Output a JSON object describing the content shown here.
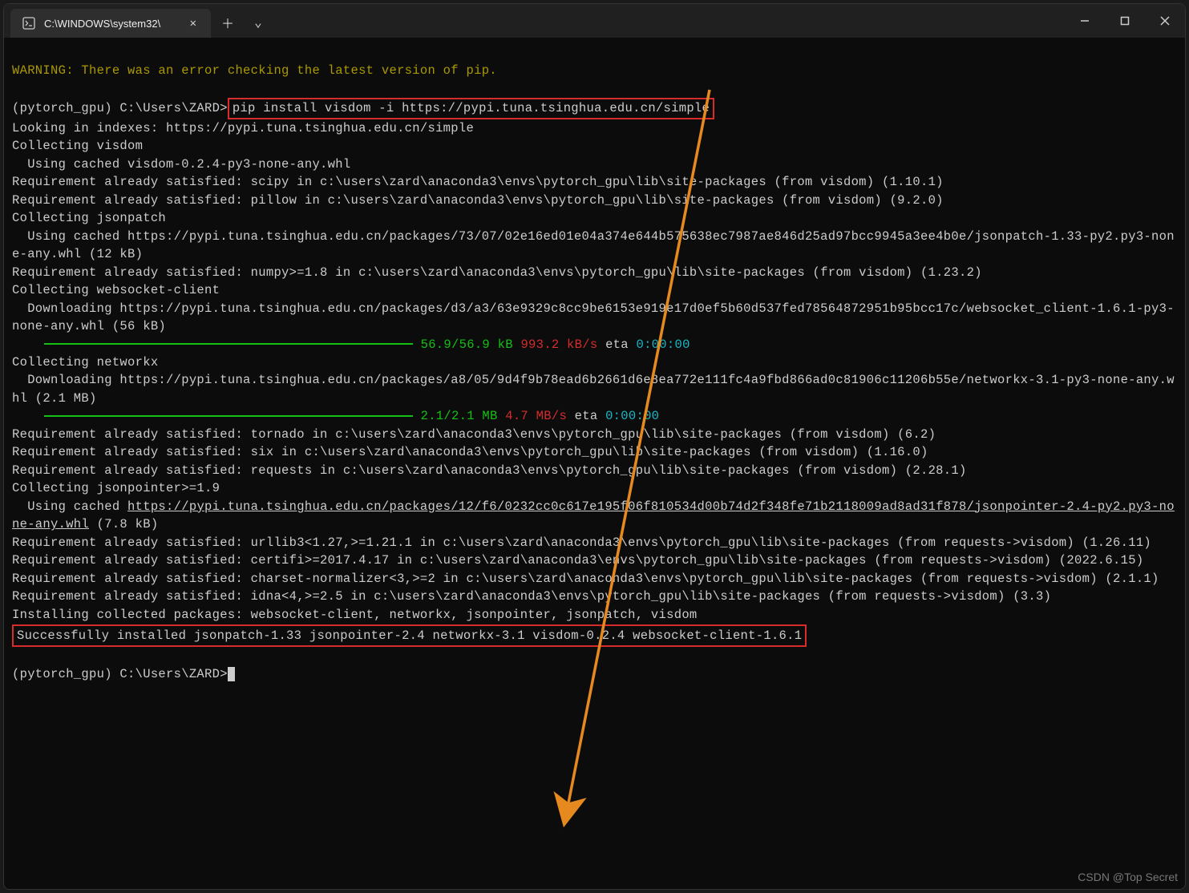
{
  "titlebar": {
    "tab_title": "C:\\WINDOWS\\system32\\"
  },
  "terminal": {
    "warning": "WARNING: There was an error checking the latest version of pip.",
    "prompt1_env": "(pytorch_gpu) ",
    "prompt1_path": "C:\\Users\\ZARD>",
    "command": "pip install visdom -i https://pypi.tuna.tsinghua.edu.cn/simple",
    "l_index": "Looking in indexes: https://pypi.tuna.tsinghua.edu.cn/simple",
    "l_coll_visdom": "Collecting visdom",
    "l_cache_visdom": "  Using cached visdom-0.2.4-py3-none-any.whl",
    "l_req_scipy": "Requirement already satisfied: scipy in c:\\users\\zard\\anaconda3\\envs\\pytorch_gpu\\lib\\site-packages (from visdom) (1.10.1)",
    "l_req_pillow": "Requirement already satisfied: pillow in c:\\users\\zard\\anaconda3\\envs\\pytorch_gpu\\lib\\site-packages (from visdom) (9.2.0)",
    "l_coll_jsonpatch": "Collecting jsonpatch",
    "l_cache_jsonpatch": "  Using cached https://pypi.tuna.tsinghua.edu.cn/packages/73/07/02e16ed01e04a374e644b575638ec7987ae846d25ad97bcc9945a3ee4b0e/jsonpatch-1.33-py2.py3-none-any.whl (12 kB)",
    "l_req_numpy": "Requirement already satisfied: numpy>=1.8 in c:\\users\\zard\\anaconda3\\envs\\pytorch_gpu\\lib\\site-packages (from visdom) (1.23.2)",
    "l_coll_ws": "Collecting websocket-client",
    "l_dl_ws": "  Downloading https://pypi.tuna.tsinghua.edu.cn/packages/d3/a3/63e9329c8cc9be6153e919e17d0ef5b60d537fed78564872951b95bcc17c/websocket_client-1.6.1-py3-none-any.whl (56 kB)",
    "progress1_size": "56.9/56.9 kB",
    "progress1_speed": "993.2 kB/s",
    "progress1_eta_lbl": "eta",
    "progress1_eta": "0:00:00",
    "l_coll_nx": "Collecting networkx",
    "l_dl_nx": "  Downloading https://pypi.tuna.tsinghua.edu.cn/packages/a8/05/9d4f9b78ead6b2661d6e8ea772e111fc4a9fbd866ad0c81906c11206b55e/networkx-3.1-py3-none-any.whl (2.1 MB)",
    "progress2_size": "2.1/2.1 MB",
    "progress2_speed": "4.7 MB/s",
    "progress2_eta_lbl": "eta",
    "progress2_eta": "0:00:00",
    "l_req_tornado": "Requirement already satisfied: tornado in c:\\users\\zard\\anaconda3\\envs\\pytorch_gpu\\lib\\site-packages (from visdom) (6.2)",
    "l_req_six": "Requirement already satisfied: six in c:\\users\\zard\\anaconda3\\envs\\pytorch_gpu\\lib\\site-packages (from visdom) (1.16.0)",
    "l_req_requests": "Requirement already satisfied: requests in c:\\users\\zard\\anaconda3\\envs\\pytorch_gpu\\lib\\site-packages (from visdom) (2.28.1)",
    "l_coll_jp": "Collecting jsonpointer>=1.9",
    "l_cache_jp_pre": "  Using cached ",
    "l_cache_jp_url": "https://pypi.tuna.tsinghua.edu.cn/packages/12/f6/0232cc0c617e195f06f810534d00b74d2f348fe71b2118009ad8ad31f878/jsonpointer-2.4-py2.py3-none-any.whl",
    "l_cache_jp_suf": " (7.8 kB)",
    "l_req_urllib3": "Requirement already satisfied: urllib3<1.27,>=1.21.1 in c:\\users\\zard\\anaconda3\\envs\\pytorch_gpu\\lib\\site-packages (from requests->visdom) (1.26.11)",
    "l_req_certifi": "Requirement already satisfied: certifi>=2017.4.17 in c:\\users\\zard\\anaconda3\\envs\\pytorch_gpu\\lib\\site-packages (from requests->visdom) (2022.6.15)",
    "l_req_charset": "Requirement already satisfied: charset-normalizer<3,>=2 in c:\\users\\zard\\anaconda3\\envs\\pytorch_gpu\\lib\\site-packages (from requests->visdom) (2.1.1)",
    "l_req_idna": "Requirement already satisfied: idna<4,>=2.5 in c:\\users\\zard\\anaconda3\\envs\\pytorch_gpu\\lib\\site-packages (from requests->visdom) (3.3)",
    "l_install": "Installing collected packages: websocket-client, networkx, jsonpointer, jsonpatch, visdom",
    "l_success": "Successfully installed jsonpatch-1.33 jsonpointer-2.4 networkx-3.1 visdom-0.2.4 websocket-client-1.6.1",
    "prompt2": "(pytorch_gpu) C:\\Users\\ZARD>"
  },
  "watermark": "CSDN @Top Secret"
}
